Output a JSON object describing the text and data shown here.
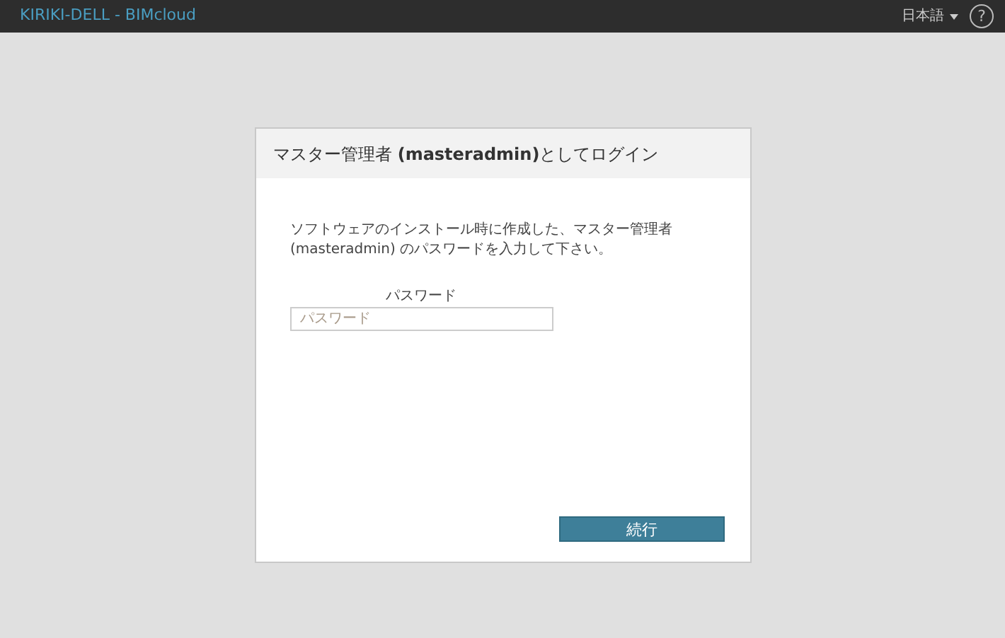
{
  "header": {
    "title": "KIRIKI-DELL - BIMcloud",
    "language": "日本語",
    "help": "?"
  },
  "dialog": {
    "title": "マスター管理者 **(masteradmin)**としてログイン",
    "description": "ソフトウェアのインストール時に作成した、マスター管理者 (masteradmin) のパスワードを入力して下さい。",
    "field_label": "パスワード",
    "placeholder": "パスワード",
    "button": "続行"
  }
}
